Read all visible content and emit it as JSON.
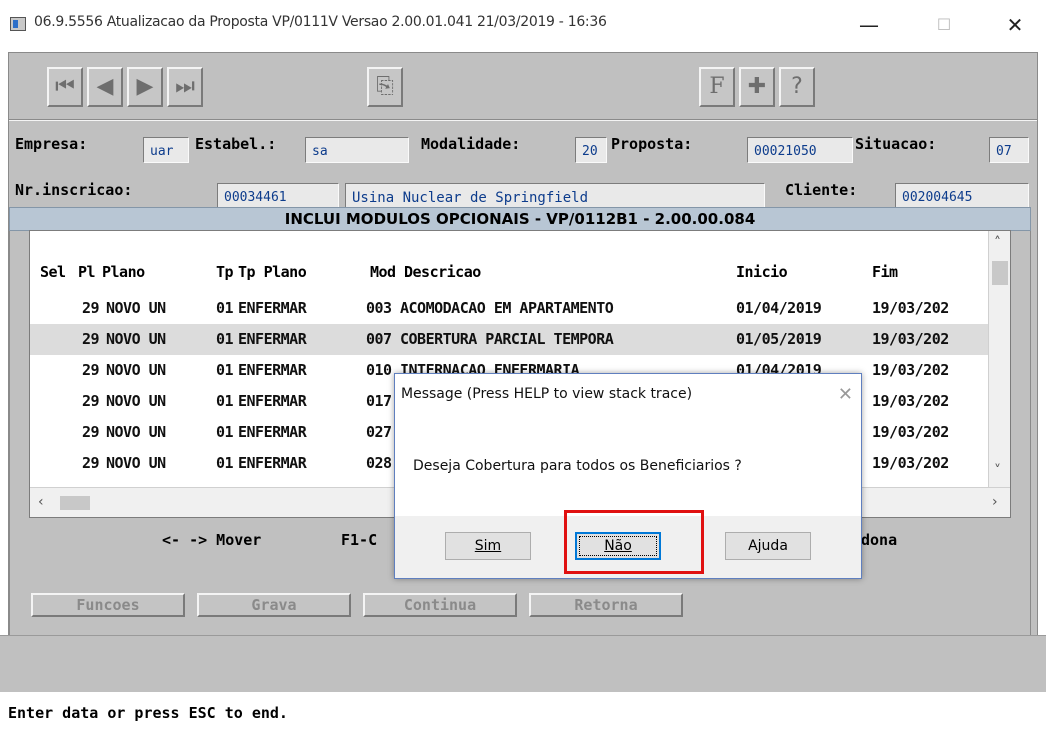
{
  "window": {
    "title": "06.9.5556 Atualizacao da Proposta VP/0111V Versao 2.00.01.041 21/03/2019 - 16:36",
    "minimize_glyph": "—",
    "maximize_glyph": "☐",
    "close_glyph": "✕"
  },
  "toolbar": {
    "icons": [
      "first-record-icon",
      "previous-record-icon",
      "next-record-icon",
      "last-record-icon",
      "copy-icon",
      "filter-icon",
      "zoom-icon",
      "help-icon"
    ],
    "glyphs": {
      "first": "⏮",
      "prev": "◀",
      "next": "▶",
      "last": "⏭",
      "copy": "⎘",
      "filter": "F",
      "zoom": "✚",
      "help": "?"
    }
  },
  "header": {
    "empresa_label": "Empresa:",
    "empresa_value": "uar",
    "estabel_label": "Estabel.:",
    "estabel_value": "sa",
    "modalidade_label": "Modalidade:",
    "modalidade_value": "20",
    "proposta_label": "Proposta:",
    "proposta_value": "00021050",
    "situacao_label": "Situacao:",
    "situacao_value": "07",
    "inscricao_label": "Nr.inscricao:",
    "inscricao_value": "00034461",
    "inscricao_name": "Usina Nuclear de Springfield",
    "cliente_label": "Cliente:",
    "cliente_value": "002004645"
  },
  "child": {
    "title": "INCLUI MODULOS OPCIONAIS - VP/0112B1 - 2.00.00.084",
    "columns": [
      "Sel",
      "Pl",
      "Plano",
      "Tp",
      "Tp Plano",
      "Mod",
      "Descricao",
      "Inicio",
      "Fim"
    ],
    "rows": [
      {
        "sel": "",
        "pl": "29",
        "plano": "NOVO UN",
        "tp": "01",
        "tp_plano": "ENFERMAR",
        "mod": "003",
        "descricao": "ACOMODACAO EM APARTAMENTO",
        "inicio": "01/04/2019",
        "fim": "19/03/202"
      },
      {
        "sel": "",
        "pl": "29",
        "plano": "NOVO UN",
        "tp": "01",
        "tp_plano": "ENFERMAR",
        "mod": "007",
        "descricao": "COBERTURA PARCIAL TEMPORA",
        "inicio": "01/05/2019",
        "fim": "19/03/202"
      },
      {
        "sel": "",
        "pl": "29",
        "plano": "NOVO UN",
        "tp": "01",
        "tp_plano": "ENFERMAR",
        "mod": "010",
        "descricao": "INTERNACAO ENFERMARIA",
        "inicio": "01/04/2019",
        "fim": "19/03/202"
      },
      {
        "sel": "",
        "pl": "29",
        "plano": "NOVO UN",
        "tp": "01",
        "tp_plano": "ENFERMAR",
        "mod": "017",
        "descricao": "",
        "inicio": "",
        "fim": "19/03/202"
      },
      {
        "sel": "",
        "pl": "29",
        "plano": "NOVO UN",
        "tp": "01",
        "tp_plano": "ENFERMAR",
        "mod": "027",
        "descricao": "",
        "inicio": "",
        "fim": "19/03/202"
      },
      {
        "sel": "",
        "pl": "29",
        "plano": "NOVO UN",
        "tp": "01",
        "tp_plano": "ENFERMAR",
        "mod": "028",
        "descricao": "",
        "inicio": "",
        "fim": "19/03/202"
      }
    ],
    "nav_text": "<- -> Mover",
    "f1_text": "F1-C",
    "done_text": "dona"
  },
  "buttons": {
    "funcoes": "Funcoes",
    "grava": "Grava",
    "continua": "Continua",
    "retorna": "Retorna"
  },
  "status": "Enter data or press ESC to end.",
  "message": {
    "title": "Message (Press HELP to view stack trace)",
    "text": "Deseja Cobertura para todos os Beneficiarios ?",
    "sim": "Sim",
    "nao": "Não",
    "ajuda": "Ajuda"
  },
  "colors": {
    "annotation_red": "#e01010",
    "field_text": "#0d3c8c"
  }
}
